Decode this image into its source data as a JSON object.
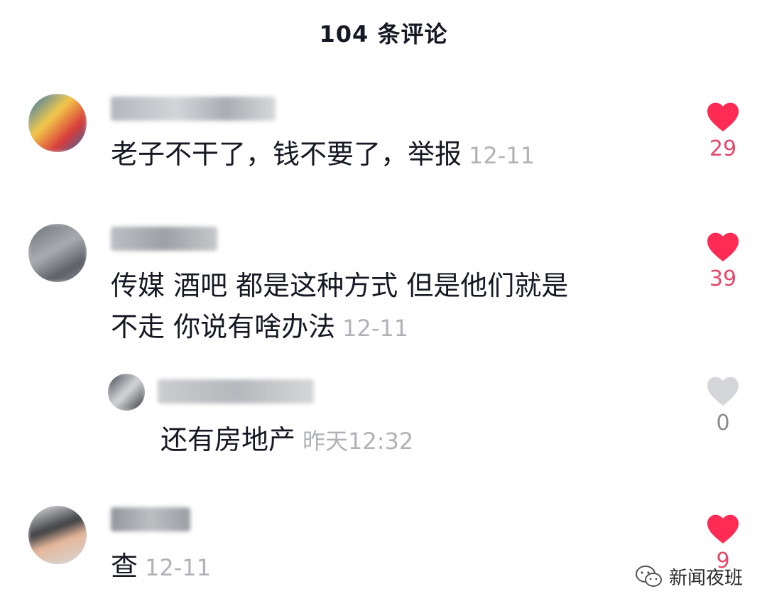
{
  "header": {
    "title": "104 条评论"
  },
  "comments": [
    {
      "text": "老子不干了，钱不要了，举报",
      "time": "12-11",
      "likes": "29",
      "liked": true
    },
    {
      "text_line1": "传媒 酒吧 都是这种方式 但是他们就是",
      "text_line2": "不走 你说有啥办法",
      "time": "12-11",
      "likes": "39",
      "liked": true,
      "reply": {
        "text": "还有房地产",
        "time": "昨天12:32",
        "likes": "0",
        "liked": false
      }
    },
    {
      "text": "查",
      "time": "12-11",
      "likes": "9",
      "liked": true
    }
  ],
  "watermark": {
    "label": "新闻夜班"
  },
  "colors": {
    "like_active": "#fe2c55",
    "like_inactive": "#d5d6d9",
    "time": "#b0b2b8"
  },
  "icons": {
    "like": "heart-icon",
    "watermark": "wechat-icon"
  }
}
